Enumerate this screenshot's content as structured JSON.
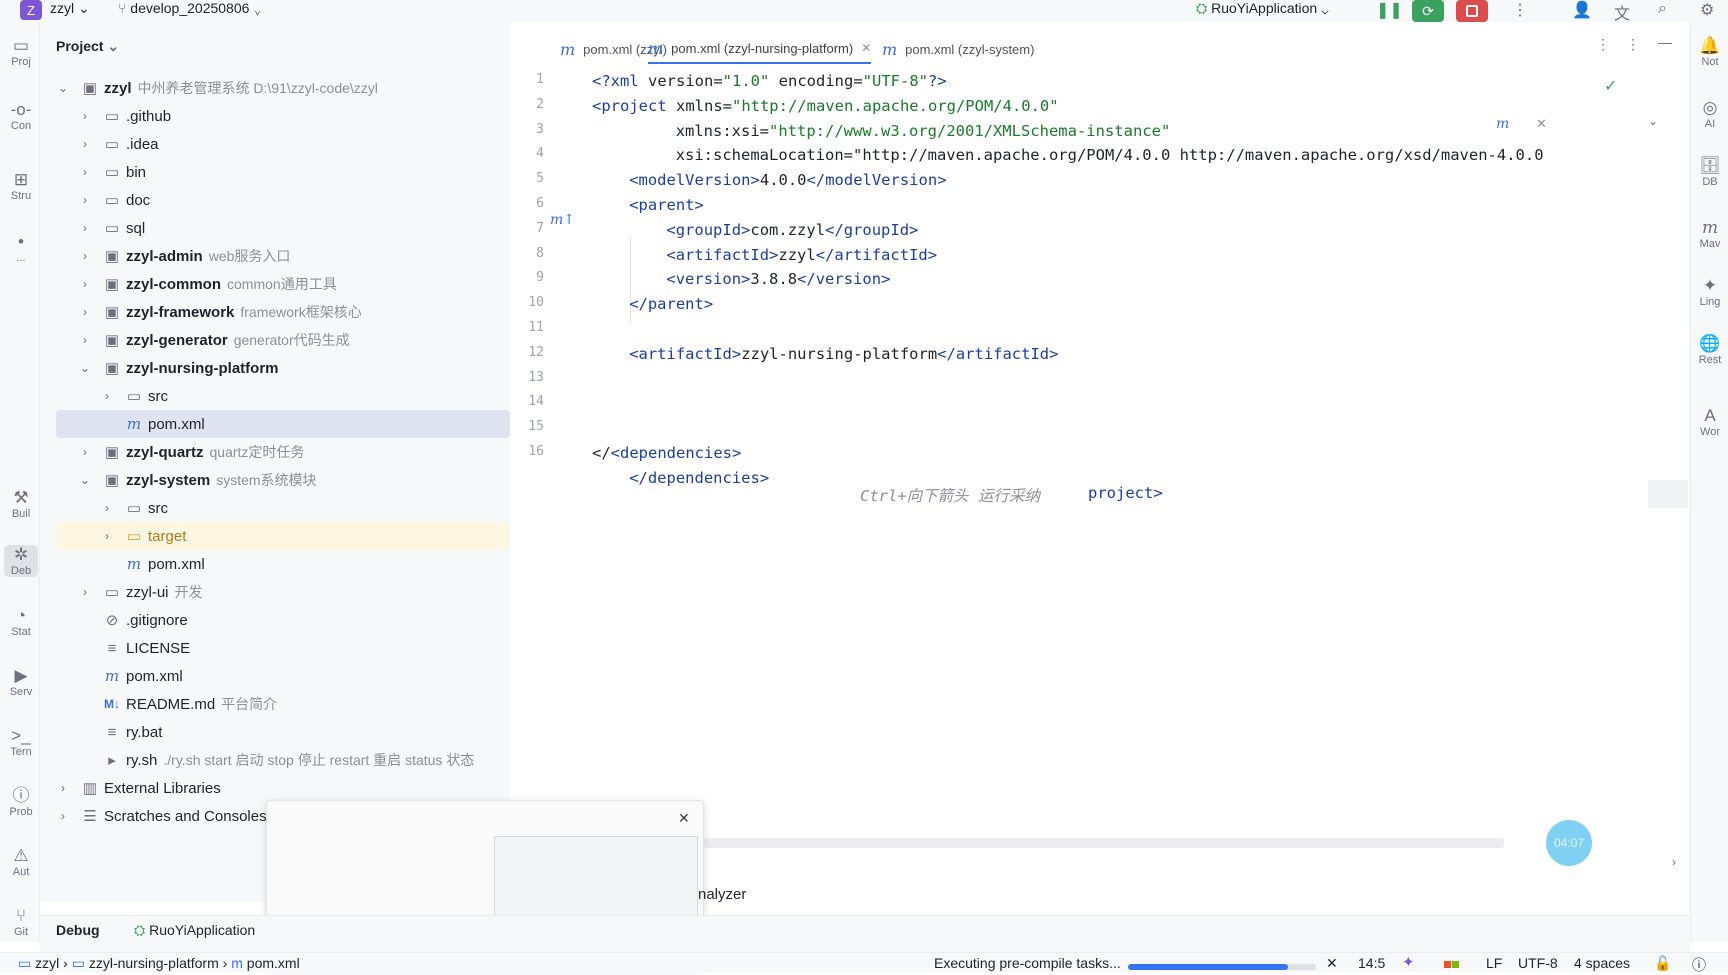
{
  "topbar": {
    "project_badge": "Z",
    "project_name": "zzyl",
    "branch": "develop_20250806",
    "run_config": "RuoYiApplication"
  },
  "left_strip": [
    {
      "icon": "folder-icon",
      "label": "Proj"
    },
    {
      "icon": "commit-icon",
      "label": "Con"
    },
    {
      "icon": "structure-icon",
      "label": "Stru"
    },
    {
      "icon": "more-icon",
      "label": "..."
    },
    {
      "icon": "build-icon",
      "label": "Buil"
    },
    {
      "icon": "debug-icon",
      "label": "Deb"
    },
    {
      "icon": "stat-icon",
      "label": "Stat"
    },
    {
      "icon": "services-icon",
      "label": "Serv"
    },
    {
      "icon": "terminal-icon",
      "label": "Tern"
    },
    {
      "icon": "problems-icon",
      "label": "Prob"
    },
    {
      "icon": "warning-icon",
      "label": "Aut"
    },
    {
      "icon": "git-icon",
      "label": "Git"
    }
  ],
  "right_strip": [
    {
      "icon": "notifications-icon",
      "label": "Not"
    },
    {
      "icon": "ai-icon",
      "label": "AI"
    },
    {
      "icon": "database-icon",
      "label": "DB"
    },
    {
      "icon": "maven-icon",
      "label": "Mav"
    },
    {
      "icon": "lingma-icon",
      "label": "Ling"
    },
    {
      "icon": "rest-icon",
      "label": "Rest"
    },
    {
      "icon": "word-icon",
      "label": "Wor"
    }
  ],
  "project": {
    "title": "Project",
    "tree": [
      {
        "label": "zzyl",
        "hint": "中州养老管理系统  D:\\91\\zzyl-code\\zzyl",
        "icon": "module",
        "bold": true,
        "depth": 0,
        "chev": "v"
      },
      {
        "label": ".github",
        "hint": "",
        "icon": "folder",
        "depth": 1,
        "chev": ">"
      },
      {
        "label": ".idea",
        "hint": "",
        "icon": "folder",
        "depth": 1,
        "chev": ">"
      },
      {
        "label": "bin",
        "hint": "",
        "icon": "folder",
        "depth": 1,
        "chev": ">"
      },
      {
        "label": "doc",
        "hint": "",
        "icon": "folder",
        "depth": 1,
        "chev": ">"
      },
      {
        "label": "sql",
        "hint": "",
        "icon": "folder",
        "depth": 1,
        "chev": ">"
      },
      {
        "label": "zzyl-admin",
        "hint": "web服务入口",
        "icon": "module",
        "bold": true,
        "depth": 1,
        "chev": ">"
      },
      {
        "label": "zzyl-common",
        "hint": "common通用工具",
        "icon": "module",
        "bold": true,
        "depth": 1,
        "chev": ">"
      },
      {
        "label": "zzyl-framework",
        "hint": "framework框架核心",
        "icon": "module",
        "bold": true,
        "depth": 1,
        "chev": ">"
      },
      {
        "label": "zzyl-generator",
        "hint": "generator代码生成",
        "icon": "module",
        "bold": true,
        "depth": 1,
        "chev": ">"
      },
      {
        "label": "zzyl-nursing-platform",
        "hint": "",
        "icon": "module",
        "bold": true,
        "depth": 1,
        "chev": "v"
      },
      {
        "label": "src",
        "hint": "",
        "icon": "folder",
        "depth": 2,
        "chev": ">"
      },
      {
        "label": "pom.xml",
        "hint": "",
        "icon": "maven",
        "depth": 2,
        "chev": "",
        "sel": true
      },
      {
        "label": "zzyl-quartz",
        "hint": "quartz定时任务",
        "icon": "module",
        "bold": true,
        "depth": 1,
        "chev": ">"
      },
      {
        "label": "zzyl-system",
        "hint": "system系统模块",
        "icon": "module",
        "bold": true,
        "depth": 1,
        "chev": "v"
      },
      {
        "label": "src",
        "hint": "",
        "icon": "folder",
        "depth": 2,
        "chev": ">"
      },
      {
        "label": "target",
        "hint": "",
        "icon": "folder",
        "depth": 2,
        "chev": ">",
        "orange": true
      },
      {
        "label": "pom.xml",
        "hint": "",
        "icon": "maven",
        "depth": 2,
        "chev": ""
      },
      {
        "label": "zzyl-ui",
        "hint": "开发",
        "icon": "folder",
        "depth": 1,
        "chev": ">"
      },
      {
        "label": ".gitignore",
        "hint": "",
        "icon": "ignore",
        "depth": 1,
        "chev": ""
      },
      {
        "label": "LICENSE",
        "hint": "",
        "icon": "text",
        "depth": 1,
        "chev": ""
      },
      {
        "label": "pom.xml",
        "hint": "",
        "icon": "maven",
        "depth": 1,
        "chev": ""
      },
      {
        "label": "README.md",
        "hint": "平台简介",
        "icon": "md",
        "depth": 1,
        "chev": ""
      },
      {
        "label": "ry.bat",
        "hint": "",
        "icon": "text",
        "depth": 1,
        "chev": ""
      },
      {
        "label": "ry.sh",
        "hint": "./ry.sh start 启动 stop 停止 restart 重启 status 状态",
        "icon": "shell",
        "depth": 1,
        "chev": ""
      },
      {
        "label": "External Libraries",
        "hint": "",
        "icon": "library",
        "depth": 0,
        "chev": ">"
      },
      {
        "label": "Scratches and Consoles",
        "hint": "",
        "icon": "scratch",
        "depth": 0,
        "chev": ">"
      }
    ]
  },
  "editor": {
    "tabs": [
      {
        "label": "pom.xml (zzyl)",
        "active": false
      },
      {
        "label": "pom.xml (zzyl-nursing-platform)",
        "active": true
      },
      {
        "label": "pom.xml (zzyl-system)",
        "active": false
      }
    ],
    "lines": [
      {
        "n": "1",
        "indent": 0,
        "text": "<?xml version=\"1.0\" encoding=\"UTF-8\"?>"
      },
      {
        "n": "2",
        "indent": 0,
        "text": "<project xmlns=\"http://maven.apache.org/POM/4.0.0\""
      },
      {
        "n": "3",
        "indent": 9,
        "text": "xmlns:xsi=\"http://www.w3.org/2001/XMLSchema-instance\""
      },
      {
        "n": "4",
        "indent": 9,
        "text": "xsi:schemaLocation=\"http://maven.apache.org/POM/4.0.0 http://maven.apache.org/xsd/maven-4.0.0"
      },
      {
        "n": "5",
        "indent": 4,
        "text": "<modelVersion>4.0.0</modelVersion>"
      },
      {
        "n": "6",
        "indent": 4,
        "text": "<parent>"
      },
      {
        "n": "7",
        "indent": 8,
        "text": "<groupId>com.zzyl</groupId>"
      },
      {
        "n": "8",
        "indent": 8,
        "text": "<artifactId>zzyl</artifactId>"
      },
      {
        "n": "9",
        "indent": 8,
        "text": "<version>3.8.8</version>"
      },
      {
        "n": "10",
        "indent": 4,
        "text": "</parent>"
      },
      {
        "n": "11",
        "indent": 0,
        "text": ""
      },
      {
        "n": "12",
        "indent": 4,
        "text": "<artifactId>zzyl-nursing-platform</artifactId>"
      },
      {
        "n": "13",
        "indent": 0,
        "text": ""
      },
      {
        "n": "14",
        "indent": 0,
        "text": ""
      },
      {
        "n": "15",
        "indent": 0,
        "text": ""
      },
      {
        "n": "16",
        "indent": 0,
        "text": "</<dependencies>"
      },
      {
        "n": "",
        "indent": 4,
        "text": "</dependencies>"
      }
    ],
    "inline_hint": "Ctrl+向下箭头 运行采纳",
    "inline_hint_tail": "project>"
  },
  "popup": {
    "behind_text": "nalyzer"
  },
  "bottom": {
    "debug_label": "Debug",
    "run_config_label": "RuoYiApplication"
  },
  "status": {
    "crumbs": [
      "zzyl",
      "zzyl-nursing-platform",
      "pom.xml"
    ],
    "task": "Executing pre-compile tasks...",
    "progress": 0.85,
    "position": "14:5",
    "line_sep": "LF",
    "encoding": "UTF-8",
    "indent": "4 spaces"
  },
  "timer": "04:07"
}
